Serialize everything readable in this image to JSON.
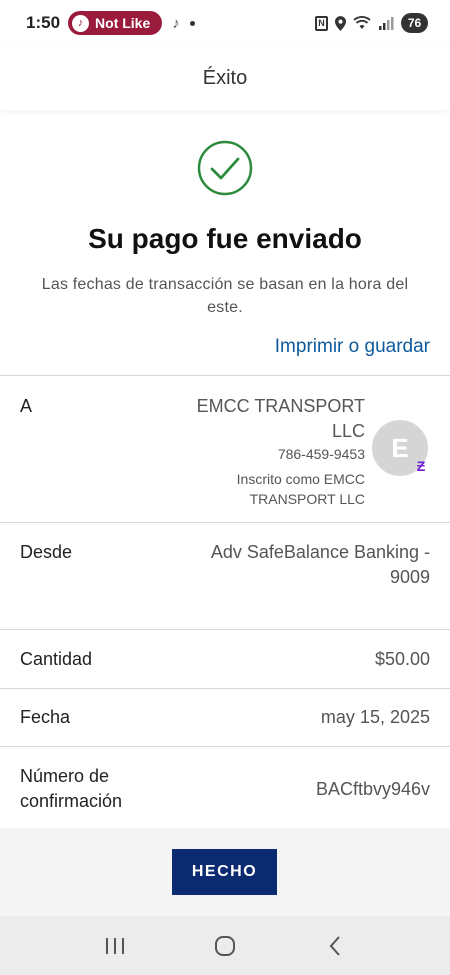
{
  "status_bar": {
    "time": "1:50",
    "notification_pill": "Not Like",
    "battery": "76"
  },
  "header": {
    "title": "Éxito"
  },
  "confirmation": {
    "title": "Su pago fue enviado",
    "subtitle": "Las fechas de transacción se basan en la hora del este.",
    "print_link": "Imprimir o guardar"
  },
  "details": {
    "to": {
      "label": "A",
      "name": "EMCC TRANSPORT LLC",
      "phone": "786-459-9453",
      "enrolled_as": "Inscrito como EMCC TRANSPORT LLC",
      "avatar_letter": "E"
    },
    "from": {
      "label": "Desde",
      "value": "Adv SafeBalance Banking - 9009"
    },
    "amount": {
      "label": "Cantidad",
      "value": "$50.00"
    },
    "date": {
      "label": "Fecha",
      "value": "may 15, 2025"
    },
    "confirmation_number": {
      "label": "Número de confirmación",
      "value": "BACftbvy946v"
    }
  },
  "actions": {
    "done": "HECHO"
  },
  "colors": {
    "success_green": "#2e8b3e",
    "link_blue": "#0e5a9c",
    "button_navy": "#0b2a6f",
    "zelle_purple": "#6d1ed4"
  }
}
